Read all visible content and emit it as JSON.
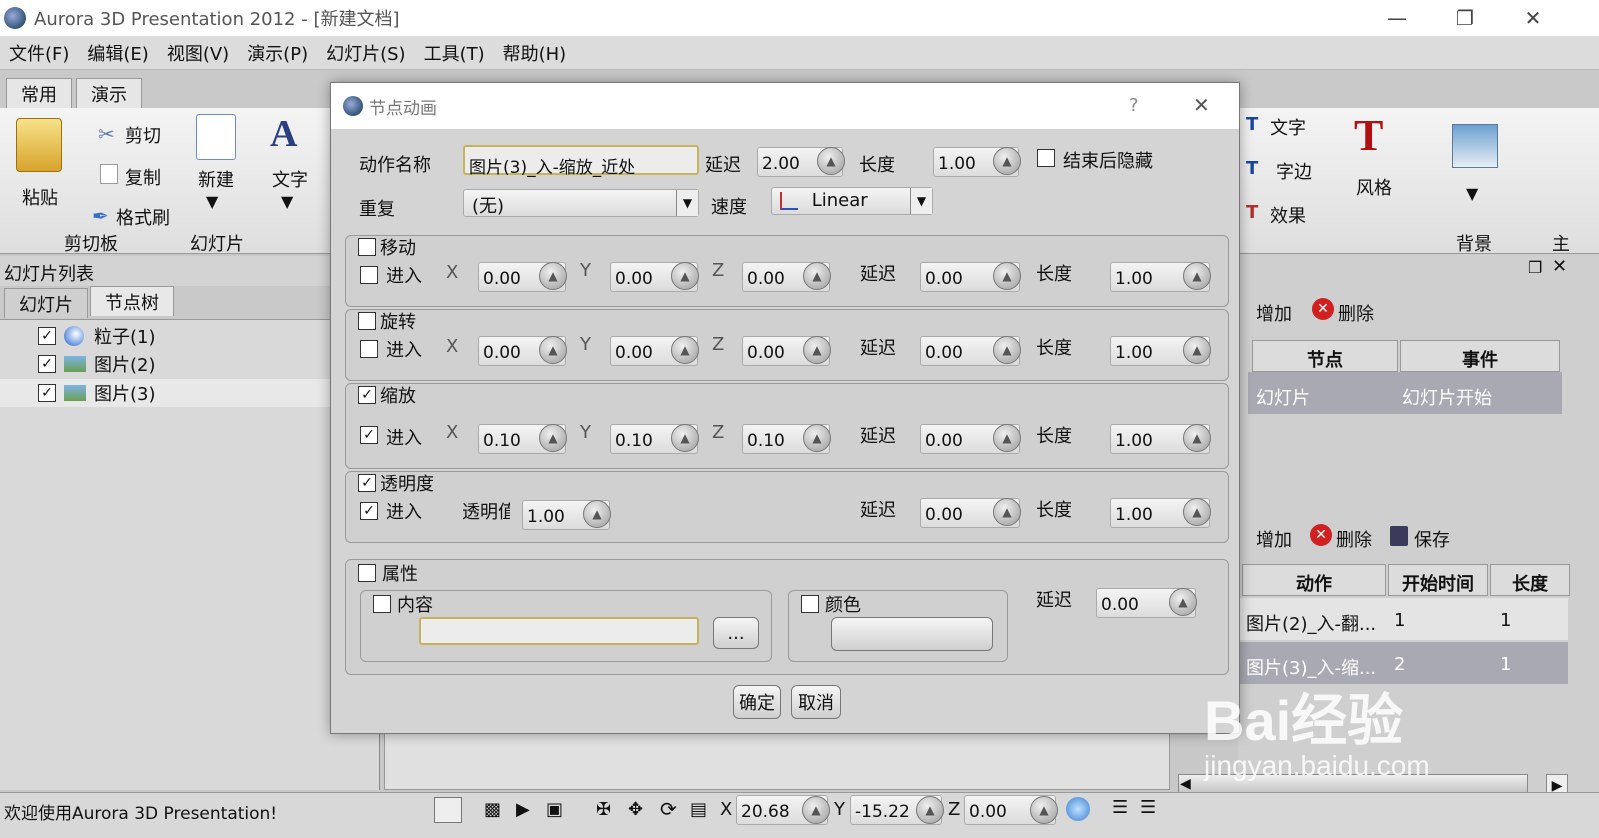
{
  "window": {
    "title": "Aurora 3D Presentation 2012 - [新建文档]"
  },
  "menu": [
    "文件(F)",
    "编辑(E)",
    "视图(V)",
    "演示(P)",
    "幻灯片(S)",
    "工具(T)",
    "帮助(H)"
  ],
  "ribbon": {
    "tabs": [
      "常用",
      "演示"
    ],
    "paste": "粘贴",
    "cut": "剪切",
    "copy": "复制",
    "format_brush": "格式刷",
    "clipboard_group": "剪切板",
    "new": "新建",
    "slide_group": "幻灯片",
    "text": "文字",
    "right_text": "文字",
    "right_edge": "字边",
    "right_effect": "效果",
    "style": "风格",
    "background": "背景",
    "main_partial": "主"
  },
  "left_panel": {
    "title": "幻灯片列表",
    "tabs": [
      "幻灯片",
      "节点树"
    ],
    "tree": [
      {
        "label": "粒子(1)",
        "checked": true
      },
      {
        "label": "图片(2)",
        "checked": true
      },
      {
        "label": "图片(3)",
        "checked": true
      }
    ]
  },
  "right_panel": {
    "events_toolbar": {
      "add": "增加",
      "delete": "删除"
    },
    "events_headers": [
      "节点",
      "事件"
    ],
    "events_rows": [
      [
        "幻灯片",
        "幻灯片开始"
      ]
    ],
    "actions_toolbar": {
      "add": "增加",
      "delete": "删除",
      "save": "保存"
    },
    "actions_headers": [
      "动作",
      "开始时间",
      "长度"
    ],
    "actions_rows": [
      [
        "图片(2)_入-翻...",
        "1",
        "1"
      ],
      [
        "图片(3)_入-缩...",
        "2",
        "1"
      ]
    ]
  },
  "dialog": {
    "title": "节点动画",
    "help": "?",
    "action_name_label": "动作名称",
    "action_name_value": "图片(3)_入-缩放_近处",
    "delay_label": "延迟",
    "delay_value": "2.00",
    "length_label": "长度",
    "length_value": "1.00",
    "hide_after_label": "结束后隐藏",
    "repeat_label": "重复",
    "repeat_value": "(无)",
    "speed_label": "速度",
    "speed_value": "Linear",
    "enter_label": "进入",
    "move": {
      "label": "移动",
      "checked": false,
      "enter": false,
      "x": "0.00",
      "y": "0.00",
      "z": "0.00",
      "delay": "0.00",
      "length": "1.00"
    },
    "rotate": {
      "label": "旋转",
      "checked": false,
      "enter": false,
      "x": "0.00",
      "y": "0.00",
      "z": "0.00",
      "delay": "0.00",
      "length": "1.00"
    },
    "scale": {
      "label": "缩放",
      "checked": true,
      "enter": true,
      "x": "0.10",
      "y": "0.10",
      "z": "0.10",
      "delay": "0.00",
      "length": "1.00"
    },
    "opacity": {
      "label": "透明度",
      "checked": true,
      "enter": true,
      "value_label": "透明值",
      "value": "1.00",
      "delay": "0.00",
      "length": "1.00"
    },
    "attribute": {
      "label": "属性",
      "content_label": "内容",
      "browse": "...",
      "color_label": "颜色",
      "delay": "0.00"
    },
    "ok": "确定",
    "cancel": "取消"
  },
  "statusbar": {
    "message": "欢迎使用Aurora 3D Presentation!",
    "x": "20.68",
    "y": "-15.22",
    "z": "0.00"
  },
  "watermark": {
    "logo": "Bai经验",
    "url": "jingyan.baidu.com"
  }
}
